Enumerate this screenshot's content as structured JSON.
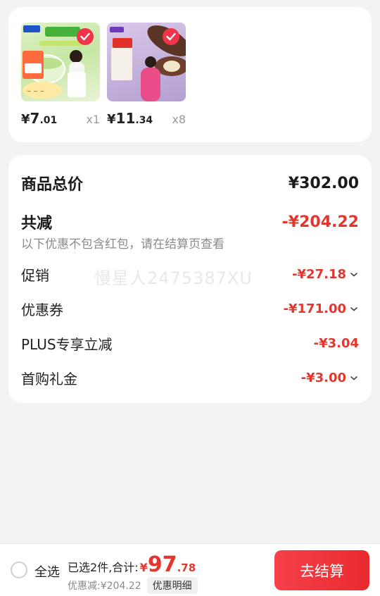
{
  "products": [
    {
      "price_currency": "¥",
      "price_int": "7",
      "price_dec": ".01",
      "qty": "x1",
      "thumb_texts": [
        "好享购",
        "哈密瓜味",
        "清甜瓜肉",
        "下单抽",
        "亲笔签名",
        "9.9",
        "一夕之间",
        "梦乡传说"
      ]
    },
    {
      "price_currency": "¥",
      "price_int": "11",
      "price_dec": ".34",
      "qty": "x8",
      "thumb_texts": [
        "5折"
      ]
    }
  ],
  "summary": {
    "total_label": "商品总价",
    "total_value": "¥302.00",
    "discount_label": "共减",
    "discount_value": "-¥204.22",
    "note": "以下优惠不包含红包，请在结算页查看",
    "watermark": "慢星人2475387XU",
    "items": [
      {
        "label": "促销",
        "value": "-¥27.18",
        "expandable": true
      },
      {
        "label": "优惠券",
        "value": "-¥171.00",
        "expandable": true
      },
      {
        "label": "PLUS专享立减",
        "value": "-¥3.04",
        "expandable": false
      },
      {
        "label": "首购礼金",
        "value": "-¥3.00",
        "expandable": true
      }
    ]
  },
  "bottom": {
    "select_all": "全选",
    "selected_text": "已选2件,合计:",
    "total_currency": "¥",
    "total_int": "97",
    "total_dec": ".78",
    "discount_text": "优惠减:¥204.22",
    "detail_button": "优惠明细",
    "checkout_button": "去结算"
  },
  "colors": {
    "accent": "#e4362e",
    "checkout": "#ee3236",
    "check_badge": "#f0344a"
  }
}
